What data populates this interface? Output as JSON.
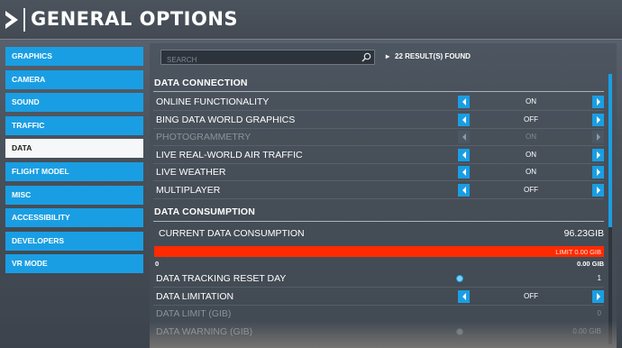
{
  "header": {
    "title": "GENERAL OPTIONS",
    "back_icon": "chevron-right-icon"
  },
  "sidebar": {
    "items": [
      {
        "label": "GRAPHICS",
        "active": false
      },
      {
        "label": "CAMERA",
        "active": false
      },
      {
        "label": "SOUND",
        "active": false
      },
      {
        "label": "TRAFFIC",
        "active": false
      },
      {
        "label": "DATA",
        "active": true
      },
      {
        "label": "FLIGHT MODEL",
        "active": false
      },
      {
        "label": "MISC",
        "active": false
      },
      {
        "label": "ACCESSIBILITY",
        "active": false
      },
      {
        "label": "DEVELOPERS",
        "active": false
      },
      {
        "label": "VR MODE",
        "active": false
      }
    ]
  },
  "search": {
    "placeholder": "SEARCH",
    "value": "",
    "icon": "search-icon"
  },
  "results": {
    "text": "22 RESULT(S) FOUND"
  },
  "sections": {
    "connection": {
      "title": "DATA CONNECTION",
      "rows": [
        {
          "label": "ONLINE FUNCTIONALITY",
          "value": "ON",
          "disabled": false
        },
        {
          "label": "BING DATA WORLD GRAPHICS",
          "value": "OFF",
          "disabled": false
        },
        {
          "label": "PHOTOGRAMMETRY",
          "value": "ON",
          "disabled": true
        },
        {
          "label": "LIVE REAL-WORLD AIR TRAFFIC",
          "value": "ON",
          "disabled": false
        },
        {
          "label": "LIVE WEATHER",
          "value": "ON",
          "disabled": false
        },
        {
          "label": "MULTIPLAYER",
          "value": "OFF",
          "disabled": false
        }
      ]
    },
    "consumption": {
      "title": "DATA CONSUMPTION",
      "current_label": "CURRENT DATA CONSUMPTION",
      "current_value": "96.23GIB",
      "limit_text": "LIMIT 0.00 GIB",
      "bar_min": "0",
      "bar_max": "0.00 GIB",
      "rows": [
        {
          "label": "DATA TRACKING RESET DAY",
          "type": "slider",
          "value": "1",
          "disabled": false
        },
        {
          "label": "DATA LIMITATION",
          "type": "toggle",
          "value": "OFF",
          "disabled": false
        },
        {
          "label": "DATA LIMIT (GIB)",
          "type": "slider",
          "value": "0",
          "disabled": true
        },
        {
          "label": "DATA WARNING (GIB)",
          "type": "slider",
          "value": "0.00 GIB",
          "disabled": true
        }
      ]
    }
  },
  "colors": {
    "accent": "#1a9ee3",
    "bar": "#ff2a00",
    "active_tab": "#f6f7f8"
  }
}
